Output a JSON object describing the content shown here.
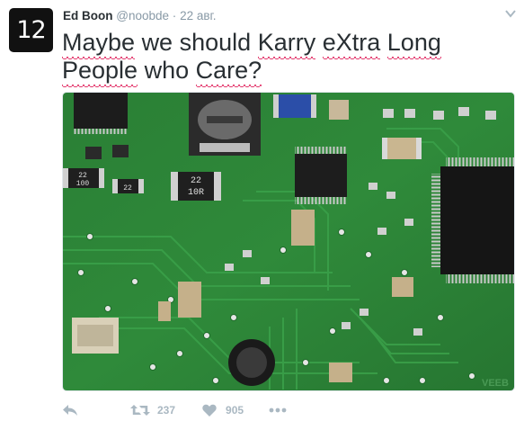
{
  "author": {
    "avatar_text": "12",
    "name": "Ed Boon",
    "handle": "@noobde",
    "separator": "·",
    "date": "22 авг."
  },
  "tweet": {
    "words": [
      "Maybe",
      "we",
      "should",
      "Karry",
      "eXtra",
      "Long",
      "People",
      "who",
      "Care?"
    ],
    "spellcheck_underlined": [
      "Maybe",
      "Karry",
      "eXtra",
      "Long",
      "People",
      "Care?"
    ],
    "media": {
      "component_labels": [
        "22",
        "100",
        "22",
        "22",
        "10R"
      ],
      "watermark": "VEEB"
    }
  },
  "actions": {
    "reply_icon": "reply-icon",
    "retweet_icon": "retweet-icon",
    "retweet_count": "237",
    "like_icon": "heart-icon",
    "like_count": "905",
    "more_icon": "more-dots-icon"
  },
  "colors": {
    "name": "#292f33",
    "muted": "#8899a6",
    "action_icon": "#aab8c2",
    "spellcheck": "#e0245e",
    "pcb_green": "#2f8a3a"
  }
}
